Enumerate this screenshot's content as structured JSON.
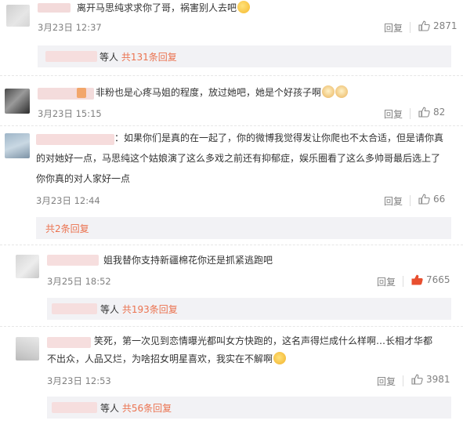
{
  "comments": [
    {
      "text": "离开马思纯求求你了哥，祸害别人去吧",
      "time": "3月23日 12:37",
      "reply": "回复",
      "likes": "2871",
      "sub_more": {
        "prefix": "等人",
        "link": "共131条回复"
      }
    },
    {
      "text": "非粉也是心疼马姐的程度，放过她吧，她是个好孩子啊",
      "time": "3月23日 15:15",
      "reply": "回复",
      "likes": "82"
    },
    {
      "text_lines": [
        "：如果你们是真的在一起了，你的微博我觉得发让你爬也不太合适，但是请你真",
        "的对她好一点，马思纯这个姑娘演了这么多戏之前还有抑郁症，娱乐圈看了这么多帅哥最后选上了",
        "你你真的对人家好一点"
      ],
      "time": "3月23日 12:44",
      "reply": "回复",
      "likes": "66",
      "sub_more": {
        "link": "共2条回复"
      }
    }
  ],
  "replies": [
    {
      "text": "姐我替你支持新疆棉花你还是抓紧逃跑吧",
      "time": "3月25日 18:52",
      "reply": "回复",
      "likes": "7665",
      "sub_more": {
        "prefix": "等人",
        "link": "共193条回复"
      }
    },
    {
      "text_lines": [
        "笑死，第一次见到恋情曝光都叫女方快跑的，这名声得烂成什么样啊…长相才华都",
        "不出众，人品又烂，为啥招女明星喜欢，我实在不解啊"
      ],
      "time": "3月23日 12:53",
      "reply": "回复",
      "likes": "3981",
      "sub_more": {
        "prefix": "等人",
        "link": "共56条回复"
      }
    }
  ],
  "colors": {
    "accent": "#eb7350",
    "muted": "#808080",
    "subbar_bg": "#f2f2f5",
    "liked_red": "#e84f2f"
  }
}
